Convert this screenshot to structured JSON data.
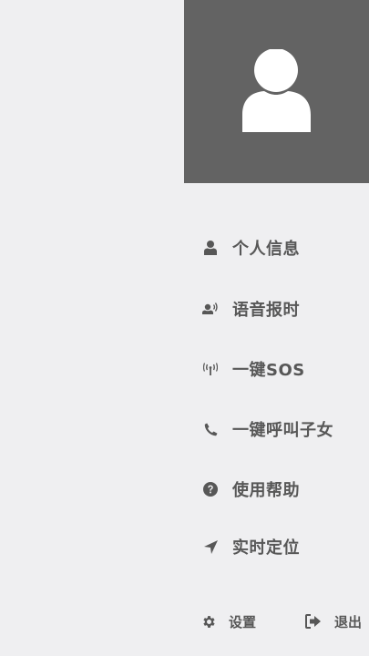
{
  "drawer": {
    "menu": [
      {
        "label": "个人信息",
        "icon": "user-icon"
      },
      {
        "label": "语音报时",
        "icon": "voice-speak-icon"
      },
      {
        "label": "一键SOS",
        "icon": "sos-antenna-icon"
      },
      {
        "label": "一键呼叫子女",
        "icon": "phone-icon"
      },
      {
        "label": "使用帮助",
        "icon": "question-circle-icon"
      },
      {
        "label": "实时定位",
        "icon": "location-arrow-icon"
      }
    ],
    "footer": {
      "settings_label": "设置",
      "logout_label": "退出"
    }
  },
  "colors": {
    "background": "#efeff1",
    "header": "#636363",
    "text": "#575757",
    "avatar": "#ffffff"
  }
}
